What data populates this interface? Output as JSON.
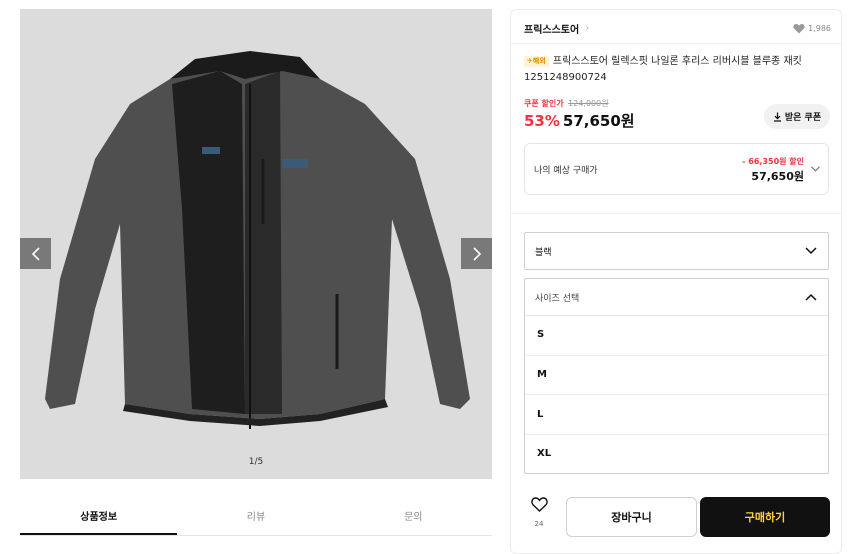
{
  "gallery": {
    "counter": "1/5",
    "image_alt": "product-photo"
  },
  "tabs": [
    {
      "label": "상품정보"
    },
    {
      "label": "리뷰"
    },
    {
      "label": "문의"
    }
  ],
  "store": {
    "name": "프릭스스토어",
    "likes": "1,986"
  },
  "product": {
    "badge": "해외",
    "title": "프릭스스토어 릴렉스핏 나일론 후리스 리버시블 블루종 재킷 1251248900724"
  },
  "pricing": {
    "coupon_label": "쿠폰 할인가",
    "original_price": "124,000원",
    "discount": "53%",
    "price": "57,650원",
    "coupon_button": "받은 쿠폰"
  },
  "expected": {
    "label": "나의 예상 구매가",
    "discount_text": "- 66,350원 할인",
    "price": "57,650원"
  },
  "options": {
    "color_value": "블랙",
    "size_placeholder": "사이즈 선택",
    "sizes": [
      "S",
      "M",
      "L",
      "XL"
    ]
  },
  "actions": {
    "wish_count": "24",
    "cart_label": "장바구니",
    "buy_label": "구매하기"
  },
  "colors": {
    "accent_red": "#ef3340",
    "buy_text": "#ffd43b"
  }
}
